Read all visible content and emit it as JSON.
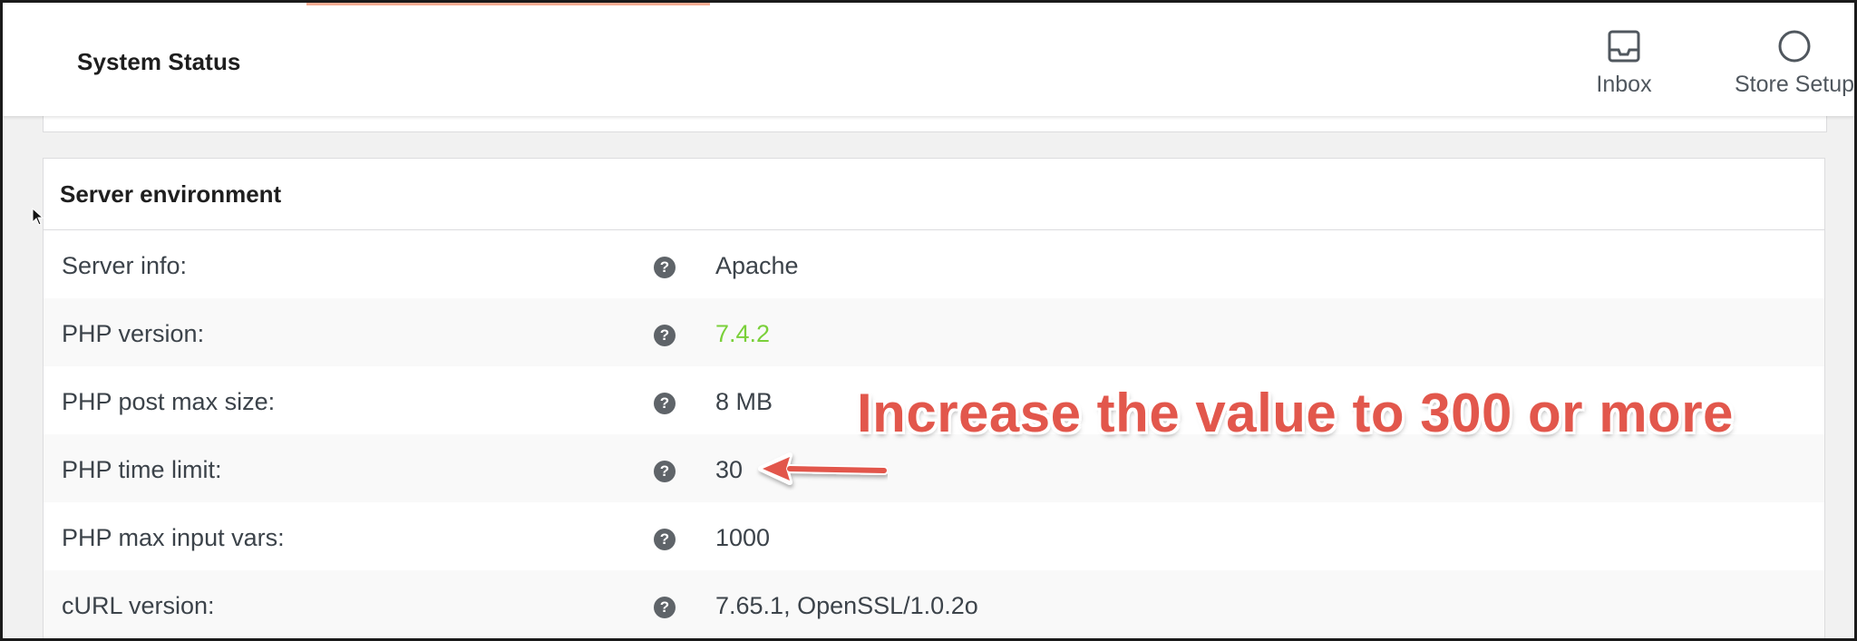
{
  "header": {
    "title": "System Status",
    "actions": [
      {
        "label": "Inbox",
        "icon": "inbox-icon"
      },
      {
        "label": "Store Setup",
        "icon": "circle-progress-icon"
      }
    ]
  },
  "panel": {
    "title": "Server environment",
    "rows": [
      {
        "label": "Server info:",
        "value": "Apache",
        "status": "normal"
      },
      {
        "label": "PHP version:",
        "value": "7.4.2",
        "status": "good"
      },
      {
        "label": "PHP post max size:",
        "value": "8 MB",
        "status": "normal"
      },
      {
        "label": "PHP time limit:",
        "value": "30",
        "status": "normal"
      },
      {
        "label": "PHP max input vars:",
        "value": "1000",
        "status": "normal"
      },
      {
        "label": "cURL version:",
        "value": "7.65.1, OpenSSL/1.0.2o",
        "status": "normal"
      }
    ],
    "help_glyph": "?"
  },
  "annotation": {
    "text": "Increase the value to 300 or more",
    "color": "#e2574c"
  },
  "colors": {
    "good_value": "#7ad03a",
    "help_icon_bg": "#5f6469",
    "accent": "#f06a3a"
  }
}
